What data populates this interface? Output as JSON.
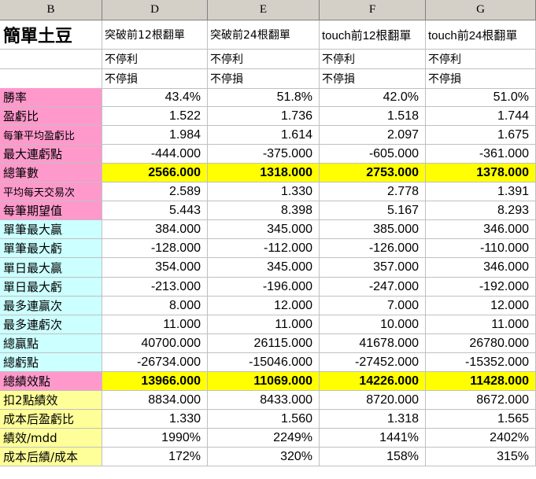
{
  "columns": {
    "headers": [
      "B",
      "D",
      "E",
      "F",
      "G"
    ]
  },
  "title": "簡單土豆",
  "strategies": [
    "突破前12根翻單",
    "突破前24根翻單",
    "touch前12根翻單",
    "touch前24根翻單"
  ],
  "condition_rows": [
    [
      "不停利",
      "不停利",
      "不停利",
      "不停利"
    ],
    [
      "不停損",
      "不停損",
      "不停損",
      "不停損"
    ]
  ],
  "rows": [
    {
      "label": "勝率",
      "values": [
        "43.4%",
        "51.8%",
        "42.0%",
        "51.0%"
      ]
    },
    {
      "label": "盈虧比",
      "values": [
        "1.522",
        "1.736",
        "1.518",
        "1.744"
      ]
    },
    {
      "label": "每筆平均盈虧比",
      "values": [
        "1.984",
        "1.614",
        "2.097",
        "1.675"
      ]
    },
    {
      "label": "最大連虧點",
      "values": [
        "-444.000",
        "-375.000",
        "-605.000",
        "-361.000"
      ]
    },
    {
      "label": "總筆數",
      "values": [
        "2566.000",
        "1318.000",
        "2753.000",
        "1378.000"
      ]
    },
    {
      "label": "平均每天交易次",
      "values": [
        "2.589",
        "1.330",
        "2.778",
        "1.391"
      ]
    },
    {
      "label": "每筆期望值",
      "values": [
        "5.443",
        "8.398",
        "5.167",
        "8.293"
      ]
    },
    {
      "label": "單筆最大贏",
      "values": [
        "384.000",
        "345.000",
        "385.000",
        "346.000"
      ]
    },
    {
      "label": "單筆最大虧",
      "values": [
        "-128.000",
        "-112.000",
        "-126.000",
        "-110.000"
      ]
    },
    {
      "label": "單日最大贏",
      "values": [
        "354.000",
        "345.000",
        "357.000",
        "346.000"
      ]
    },
    {
      "label": "單日最大虧",
      "values": [
        "-213.000",
        "-196.000",
        "-247.000",
        "-192.000"
      ]
    },
    {
      "label": "最多連贏次",
      "values": [
        "8.000",
        "12.000",
        "7.000",
        "12.000"
      ]
    },
    {
      "label": "最多連虧次",
      "values": [
        "11.000",
        "11.000",
        "10.000",
        "11.000"
      ]
    },
    {
      "label": "總贏點",
      "values": [
        "40700.000",
        "26115.000",
        "41678.000",
        "26780.000"
      ]
    },
    {
      "label": "總虧點",
      "values": [
        "-26734.000",
        "-15046.000",
        "-27452.000",
        "-15352.000"
      ]
    },
    {
      "label": "總績效點",
      "values": [
        "13966.000",
        "11069.000",
        "14226.000",
        "11428.000"
      ]
    },
    {
      "label": "扣2點績效",
      "values": [
        "8834.000",
        "8433.000",
        "8720.000",
        "8672.000"
      ]
    },
    {
      "label": "成本后盈虧比",
      "values": [
        "1.330",
        "1.560",
        "1.318",
        "1.565"
      ]
    },
    {
      "label": "績效/mdd",
      "values": [
        "1990%",
        "2249%",
        "1441%",
        "2402%"
      ]
    },
    {
      "label": "成本后績/成本",
      "values": [
        "172%",
        "320%",
        "158%",
        "315%"
      ]
    }
  ],
  "colors": {
    "pink": "#ff99cc",
    "cyan": "#ccffff",
    "light_yellow": "#ffff99",
    "highlight_yellow": "#ffff00",
    "header_gray": "#d4d0c8"
  }
}
